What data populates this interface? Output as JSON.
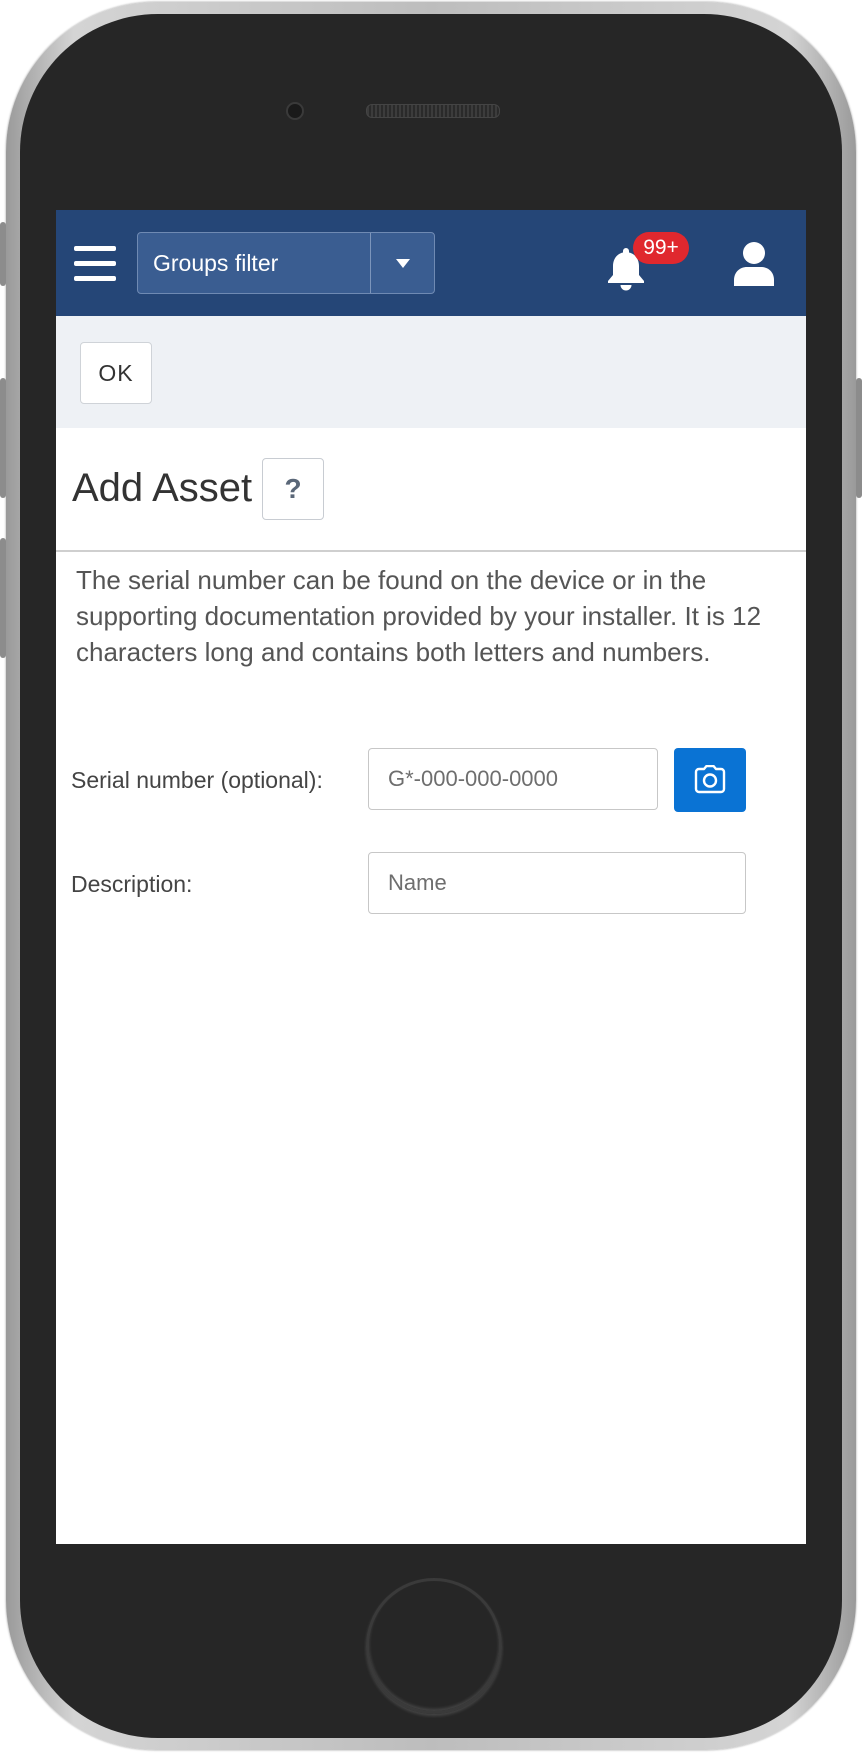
{
  "header": {
    "groups_filter_label": "Groups filter",
    "notification_badge": "99+"
  },
  "toolbar": {
    "ok_label": "OK"
  },
  "page": {
    "title": "Add Asset",
    "help_label": "?",
    "info_text": "The serial number can be found on the device or in the supporting documentation provided by your installer. It is 12 characters long and contains both letters and numbers."
  },
  "form": {
    "serial": {
      "label": "Serial number (optional):",
      "value": "",
      "placeholder": "G*-000-000-0000"
    },
    "description": {
      "label": "Description:",
      "value": "",
      "placeholder": "Name"
    }
  },
  "colors": {
    "header_bg": "#254677",
    "badge_bg": "#e0282e",
    "camera_button_bg": "#0a73d4",
    "toolbar_bg": "#eef1f5"
  },
  "icons": {
    "menu": "hamburger-menu-icon",
    "dropdown": "caret-down-icon",
    "notifications": "bell-icon",
    "user": "user-icon",
    "camera": "camera-icon"
  }
}
